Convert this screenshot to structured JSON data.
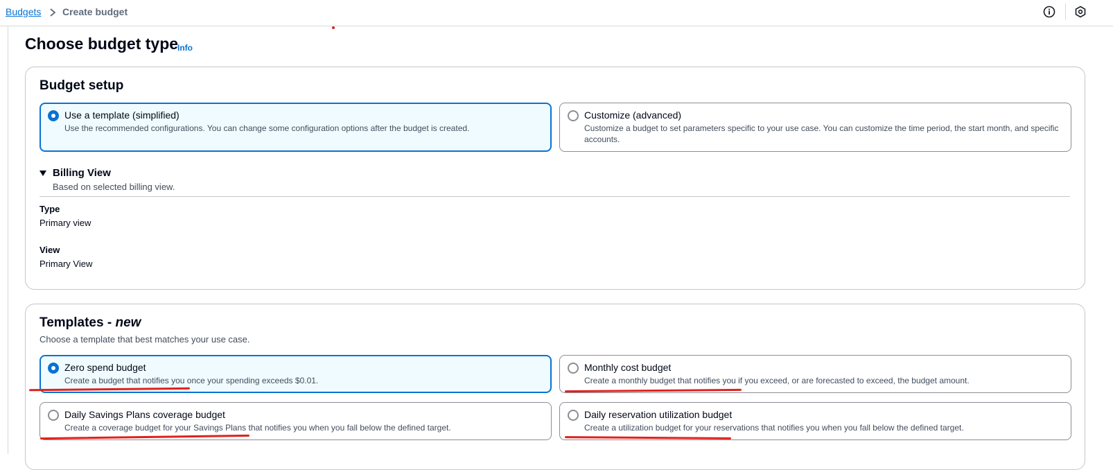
{
  "breadcrumb": {
    "parent": "Budgets",
    "current": "Create budget"
  },
  "header": {
    "title": "Choose budget type",
    "info_label": "Info"
  },
  "budget_setup": {
    "title": "Budget setup",
    "options": [
      {
        "label": "Use a template (simplified)",
        "description": "Use the recommended configurations. You can change some configuration options after the budget is created.",
        "selected": true
      },
      {
        "label": "Customize (advanced)",
        "description": "Customize a budget to set parameters specific to your use case. You can customize the time period, the start month, and specific accounts.",
        "selected": false
      }
    ],
    "billing_view": {
      "title": "Billing View",
      "subtitle": "Based on selected billing view.",
      "type_label": "Type",
      "type_value": "Primary view",
      "view_label": "View",
      "view_value": "Primary View"
    }
  },
  "templates": {
    "title_prefix": "Templates - ",
    "title_emphasis": "new",
    "subtitle": "Choose a template that best matches your use case.",
    "options": [
      {
        "label": "Zero spend budget",
        "description": "Create a budget that notifies you once your spending exceeds $0.01.",
        "selected": true
      },
      {
        "label": "Monthly cost budget",
        "description": "Create a monthly budget that notifies you if you exceed, or are forecasted to exceed, the budget amount.",
        "selected": false
      },
      {
        "label": "Daily Savings Plans coverage budget",
        "description": "Create a coverage budget for your Savings Plans that notifies you when you fall below the defined target.",
        "selected": false
      },
      {
        "label": "Daily reservation utilization budget",
        "description": "Create a utilization budget for your reservations that notifies you when you fall below the defined target.",
        "selected": false
      }
    ]
  },
  "icons": {
    "info": "info-circle-icon",
    "settings": "hexagon-icon",
    "breadcrumb_separator": "chevron-right-icon",
    "expand": "caret-down-icon"
  },
  "colors": {
    "accent": "#0972d3",
    "selected_bg": "#f0fbff",
    "annotation": "#e0211d"
  }
}
